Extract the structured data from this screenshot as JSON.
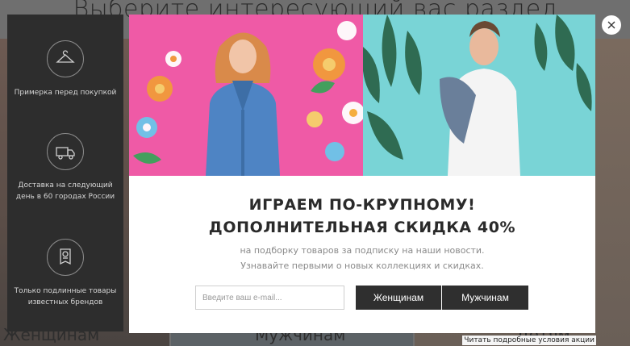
{
  "background": {
    "title": "Выберите интересующий вас раздел",
    "categories": [
      "Женщинам",
      "Мужчинам",
      "Детям"
    ],
    "terms_link": "Читать подробные условия акции"
  },
  "sidebar": {
    "items": [
      {
        "icon": "hanger-icon",
        "label": "Примерка перед покупкой"
      },
      {
        "icon": "delivery-truck-icon",
        "label": "Доставка на следующий день в 60 городах России"
      },
      {
        "icon": "authentic-tag-icon",
        "label": "Только подлинные товары известных брендов"
      }
    ]
  },
  "modal": {
    "title_line1": "ИГРАЕМ ПО-КРУПНОМУ!",
    "title_line2": "ДОПОЛНИТЕЛЬНАЯ СКИДКА 40%",
    "subtitle_line1": "на подборку товаров за подписку на наши новости.",
    "subtitle_line2": "Узнавайте первыми о новых коллекциях и скидках.",
    "email_placeholder": "Введите ваш e-mail...",
    "women_button": "Женщинам",
    "men_button": "Мужчинам",
    "close_icon": "close-icon",
    "colors": {
      "hero_left_bg": "#ef5aa6",
      "hero_right_bg": "#79d4d6",
      "button_bg": "#2f2f2f"
    }
  }
}
